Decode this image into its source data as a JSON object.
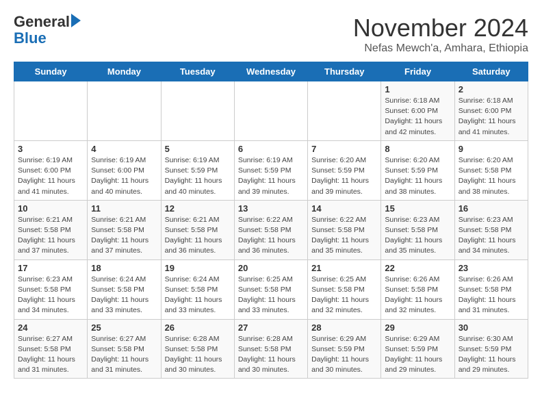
{
  "header": {
    "logo_general": "General",
    "logo_blue": "Blue",
    "month": "November 2024",
    "location": "Nefas Mewch'a, Amhara, Ethiopia"
  },
  "weekdays": [
    "Sunday",
    "Monday",
    "Tuesday",
    "Wednesday",
    "Thursday",
    "Friday",
    "Saturday"
  ],
  "weeks": [
    [
      {
        "day": "",
        "detail": ""
      },
      {
        "day": "",
        "detail": ""
      },
      {
        "day": "",
        "detail": ""
      },
      {
        "day": "",
        "detail": ""
      },
      {
        "day": "",
        "detail": ""
      },
      {
        "day": "1",
        "detail": "Sunrise: 6:18 AM\nSunset: 6:00 PM\nDaylight: 11 hours\nand 42 minutes."
      },
      {
        "day": "2",
        "detail": "Sunrise: 6:18 AM\nSunset: 6:00 PM\nDaylight: 11 hours\nand 41 minutes."
      }
    ],
    [
      {
        "day": "3",
        "detail": "Sunrise: 6:19 AM\nSunset: 6:00 PM\nDaylight: 11 hours\nand 41 minutes."
      },
      {
        "day": "4",
        "detail": "Sunrise: 6:19 AM\nSunset: 6:00 PM\nDaylight: 11 hours\nand 40 minutes."
      },
      {
        "day": "5",
        "detail": "Sunrise: 6:19 AM\nSunset: 5:59 PM\nDaylight: 11 hours\nand 40 minutes."
      },
      {
        "day": "6",
        "detail": "Sunrise: 6:19 AM\nSunset: 5:59 PM\nDaylight: 11 hours\nand 39 minutes."
      },
      {
        "day": "7",
        "detail": "Sunrise: 6:20 AM\nSunset: 5:59 PM\nDaylight: 11 hours\nand 39 minutes."
      },
      {
        "day": "8",
        "detail": "Sunrise: 6:20 AM\nSunset: 5:59 PM\nDaylight: 11 hours\nand 38 minutes."
      },
      {
        "day": "9",
        "detail": "Sunrise: 6:20 AM\nSunset: 5:58 PM\nDaylight: 11 hours\nand 38 minutes."
      }
    ],
    [
      {
        "day": "10",
        "detail": "Sunrise: 6:21 AM\nSunset: 5:58 PM\nDaylight: 11 hours\nand 37 minutes."
      },
      {
        "day": "11",
        "detail": "Sunrise: 6:21 AM\nSunset: 5:58 PM\nDaylight: 11 hours\nand 37 minutes."
      },
      {
        "day": "12",
        "detail": "Sunrise: 6:21 AM\nSunset: 5:58 PM\nDaylight: 11 hours\nand 36 minutes."
      },
      {
        "day": "13",
        "detail": "Sunrise: 6:22 AM\nSunset: 5:58 PM\nDaylight: 11 hours\nand 36 minutes."
      },
      {
        "day": "14",
        "detail": "Sunrise: 6:22 AM\nSunset: 5:58 PM\nDaylight: 11 hours\nand 35 minutes."
      },
      {
        "day": "15",
        "detail": "Sunrise: 6:23 AM\nSunset: 5:58 PM\nDaylight: 11 hours\nand 35 minutes."
      },
      {
        "day": "16",
        "detail": "Sunrise: 6:23 AM\nSunset: 5:58 PM\nDaylight: 11 hours\nand 34 minutes."
      }
    ],
    [
      {
        "day": "17",
        "detail": "Sunrise: 6:23 AM\nSunset: 5:58 PM\nDaylight: 11 hours\nand 34 minutes."
      },
      {
        "day": "18",
        "detail": "Sunrise: 6:24 AM\nSunset: 5:58 PM\nDaylight: 11 hours\nand 33 minutes."
      },
      {
        "day": "19",
        "detail": "Sunrise: 6:24 AM\nSunset: 5:58 PM\nDaylight: 11 hours\nand 33 minutes."
      },
      {
        "day": "20",
        "detail": "Sunrise: 6:25 AM\nSunset: 5:58 PM\nDaylight: 11 hours\nand 33 minutes."
      },
      {
        "day": "21",
        "detail": "Sunrise: 6:25 AM\nSunset: 5:58 PM\nDaylight: 11 hours\nand 32 minutes."
      },
      {
        "day": "22",
        "detail": "Sunrise: 6:26 AM\nSunset: 5:58 PM\nDaylight: 11 hours\nand 32 minutes."
      },
      {
        "day": "23",
        "detail": "Sunrise: 6:26 AM\nSunset: 5:58 PM\nDaylight: 11 hours\nand 31 minutes."
      }
    ],
    [
      {
        "day": "24",
        "detail": "Sunrise: 6:27 AM\nSunset: 5:58 PM\nDaylight: 11 hours\nand 31 minutes."
      },
      {
        "day": "25",
        "detail": "Sunrise: 6:27 AM\nSunset: 5:58 PM\nDaylight: 11 hours\nand 31 minutes."
      },
      {
        "day": "26",
        "detail": "Sunrise: 6:28 AM\nSunset: 5:58 PM\nDaylight: 11 hours\nand 30 minutes."
      },
      {
        "day": "27",
        "detail": "Sunrise: 6:28 AM\nSunset: 5:58 PM\nDaylight: 11 hours\nand 30 minutes."
      },
      {
        "day": "28",
        "detail": "Sunrise: 6:29 AM\nSunset: 5:59 PM\nDaylight: 11 hours\nand 30 minutes."
      },
      {
        "day": "29",
        "detail": "Sunrise: 6:29 AM\nSunset: 5:59 PM\nDaylight: 11 hours\nand 29 minutes."
      },
      {
        "day": "30",
        "detail": "Sunrise: 6:30 AM\nSunset: 5:59 PM\nDaylight: 11 hours\nand 29 minutes."
      }
    ]
  ]
}
